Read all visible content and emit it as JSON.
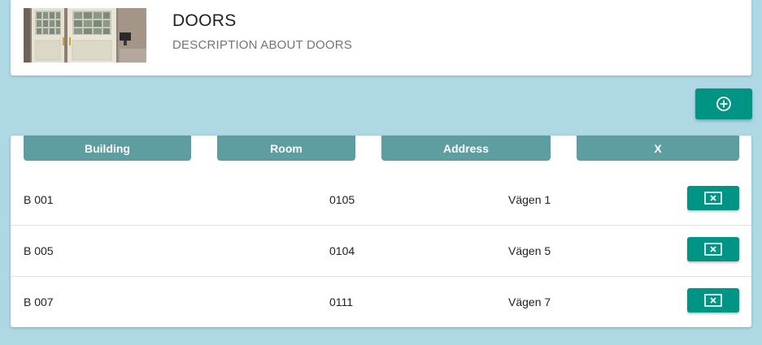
{
  "header": {
    "title": "DOORS",
    "description": "DESCRIPTION ABOUT DOORS",
    "image": "door-photo"
  },
  "toolbar": {
    "add_icon": "add-circle-icon"
  },
  "table": {
    "columns": [
      "Building",
      "Room",
      "Address",
      "X"
    ],
    "rows": [
      {
        "building": "B 001",
        "room": "0105",
        "address": "Vägen 1",
        "action_icon": "close-box-icon"
      },
      {
        "building": "B 005",
        "room": "0104",
        "address": "Vägen 5",
        "action_icon": "close-box-icon"
      },
      {
        "building": "B 007",
        "room": "0111",
        "address": "Vägen 7",
        "action_icon": "close-box-icon"
      }
    ]
  },
  "colors": {
    "background": "#add8e4",
    "primary_button": "#009485",
    "table_header": "#5e9ea0"
  }
}
